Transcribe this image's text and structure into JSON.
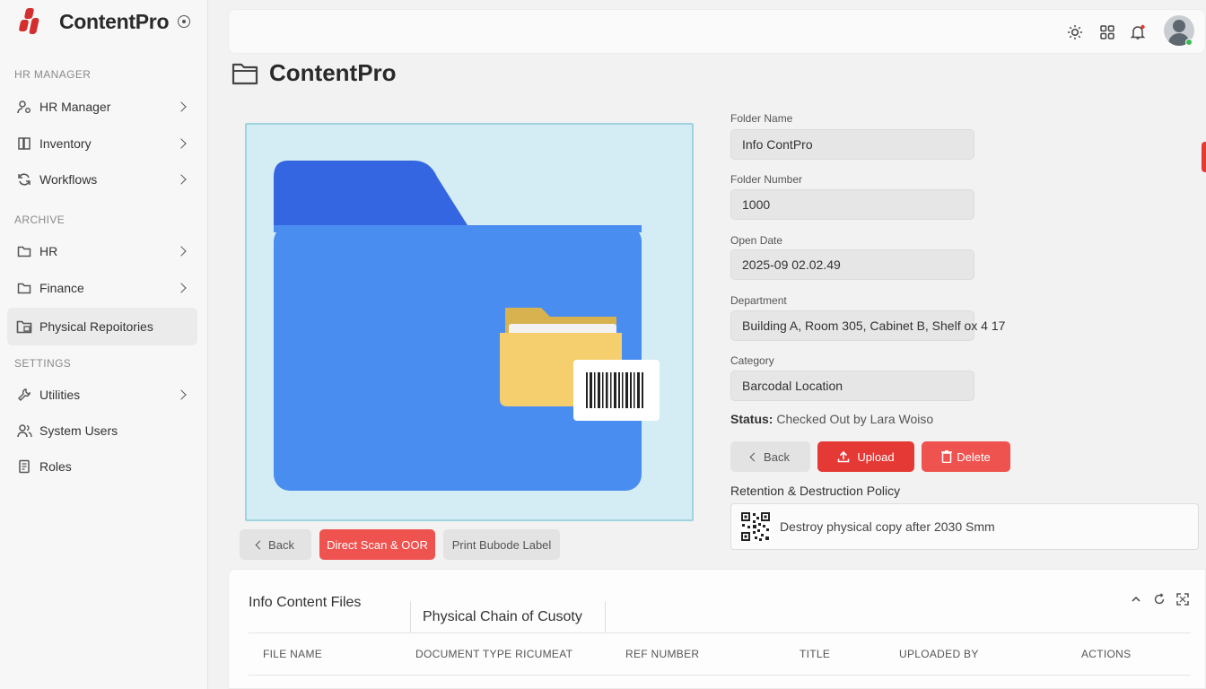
{
  "app": {
    "title": "ContentPro"
  },
  "sidebar": {
    "sections": {
      "hr_manager": "HR MANAGER",
      "archive": "ARCHIVE",
      "settings": "SETTINGS"
    },
    "items": [
      {
        "label": "HR Manager",
        "icon": "user-cog-icon"
      },
      {
        "label": "Inventory",
        "icon": "book-icon"
      },
      {
        "label": "Workflows",
        "icon": "refresh-icon"
      },
      {
        "label": "HR",
        "icon": "folder-icon"
      },
      {
        "label": "Finance",
        "icon": "folder-icon"
      },
      {
        "label": "Physical Repoitories",
        "icon": "folder-active-icon"
      },
      {
        "label": "Utilities",
        "icon": "wrench-icon"
      },
      {
        "label": "System Users",
        "icon": "users-icon"
      },
      {
        "label": "Roles",
        "icon": "document-icon"
      }
    ]
  },
  "page": {
    "title": "ContentPro"
  },
  "preview_actions": {
    "back": "Back",
    "scan": "Direct Scan & OOR",
    "print": "Print Bubode Label"
  },
  "form": {
    "folder_name": {
      "label": "Folder Name",
      "value": "Info ContPro"
    },
    "folder_number": {
      "label": "Folder Number",
      "value": "1000"
    },
    "open_date": {
      "label": "Open Date",
      "value": "2025-09 02.02.49"
    },
    "department": {
      "label": "Department",
      "value": "Building A, Room 305, Cabinet B, Shelf ox 4 17"
    },
    "category": {
      "label": "Category",
      "value": "Barcodal Location"
    },
    "status_label": "Status:",
    "status_value": "Checked Out by Lara Woiso"
  },
  "actions": {
    "back": "Back",
    "upload": "Upload",
    "delete": "Delete"
  },
  "policy": {
    "title": "Retention & Destruction Policy",
    "text": "Destroy physical copy after 2030 Smm"
  },
  "files_panel": {
    "title": "Info Content Files",
    "tab": "Physical Chain of Cusoty",
    "columns": [
      "FILE NAME",
      "DOCUMENT TYPE RICUMEAT",
      "REF NUMBER",
      "TITLE",
      "UPLOADED BY",
      "ACTIONS"
    ]
  },
  "colors": {
    "accent": "#e53935",
    "folder_blue": "#4a8df0",
    "folder_dark": "#3366e0",
    "preview_bg": "#d4ecf3"
  }
}
